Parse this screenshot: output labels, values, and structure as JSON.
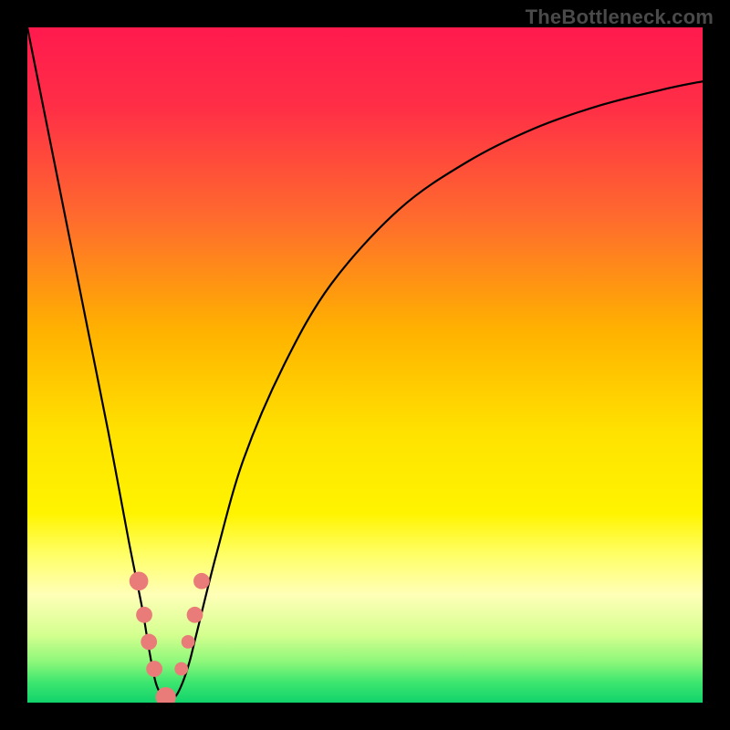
{
  "watermark": "TheBottleneck.com",
  "gradient": {
    "stops": [
      {
        "offset": 0.0,
        "color": "#ff1a4e"
      },
      {
        "offset": 0.12,
        "color": "#ff2f46"
      },
      {
        "offset": 0.28,
        "color": "#ff6a2e"
      },
      {
        "offset": 0.45,
        "color": "#ffb200"
      },
      {
        "offset": 0.6,
        "color": "#ffe200"
      },
      {
        "offset": 0.72,
        "color": "#fff400"
      },
      {
        "offset": 0.78,
        "color": "#ffff66"
      },
      {
        "offset": 0.84,
        "color": "#ffffb8"
      },
      {
        "offset": 0.9,
        "color": "#d4ff8f"
      },
      {
        "offset": 0.94,
        "color": "#8cf77a"
      },
      {
        "offset": 0.97,
        "color": "#3de66f"
      },
      {
        "offset": 1.0,
        "color": "#11d36c"
      }
    ]
  },
  "chart_data": {
    "type": "line",
    "title": "",
    "xlabel": "",
    "ylabel": "",
    "xlim": [
      0,
      100
    ],
    "ylim": [
      0,
      100
    ],
    "series": [
      {
        "name": "bottleneck-curve",
        "x": [
          0,
          3,
          6,
          9,
          12,
          15,
          17,
          18,
          19,
          20,
          21,
          22,
          23,
          24,
          25,
          28,
          32,
          38,
          45,
          55,
          65,
          75,
          85,
          95,
          100
        ],
        "y": [
          100,
          85,
          70,
          55,
          40,
          24,
          14,
          8,
          3,
          1,
          0.5,
          1,
          3,
          6,
          10,
          22,
          36,
          50,
          62,
          73,
          80,
          85,
          88.5,
          91,
          92
        ]
      }
    ],
    "markers": [
      {
        "name": "left-marker-a",
        "x": 16.5,
        "y": 18,
        "r": 1.4
      },
      {
        "name": "left-marker-b",
        "x": 17.3,
        "y": 13,
        "r": 1.2
      },
      {
        "name": "left-marker-c",
        "x": 18.0,
        "y": 9,
        "r": 1.2
      },
      {
        "name": "left-marker-d",
        "x": 18.8,
        "y": 5,
        "r": 1.2
      },
      {
        "name": "min-marker",
        "x": 20.5,
        "y": 0.8,
        "r": 1.5
      },
      {
        "name": "right-marker-a",
        "x": 22.8,
        "y": 5,
        "r": 1.0
      },
      {
        "name": "right-marker-b",
        "x": 23.8,
        "y": 9,
        "r": 1.0
      },
      {
        "name": "right-marker-c",
        "x": 24.8,
        "y": 13,
        "r": 1.2
      },
      {
        "name": "right-marker-d",
        "x": 25.8,
        "y": 18,
        "r": 1.2
      }
    ],
    "marker_color": "#e97b78"
  }
}
